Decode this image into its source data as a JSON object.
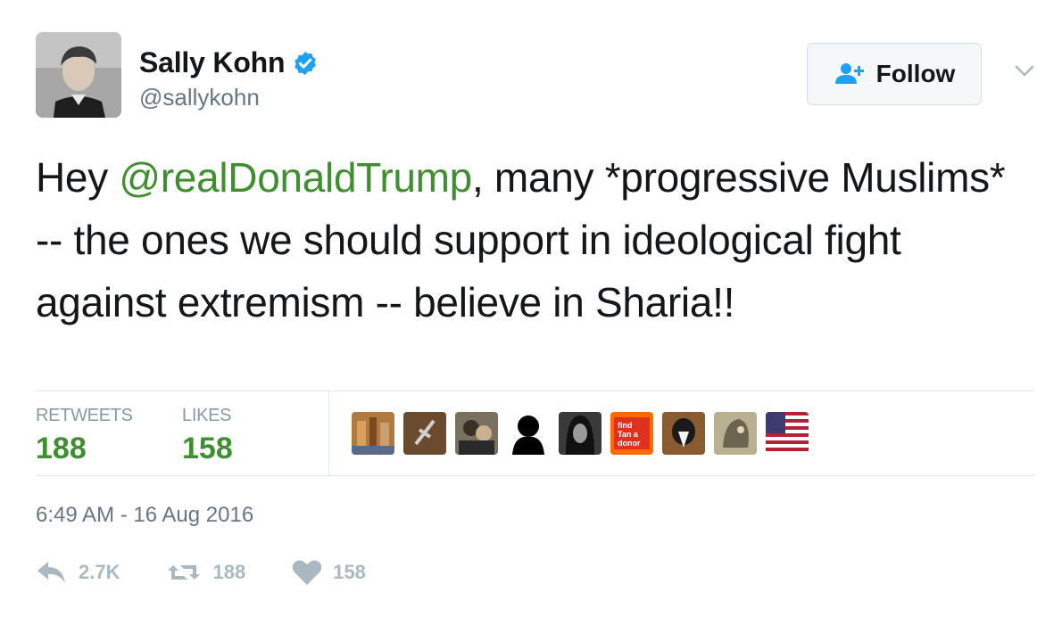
{
  "author": {
    "name": "Sally Kohn",
    "handle": "@sallykohn"
  },
  "follow_button": {
    "label": "Follow"
  },
  "tweet": {
    "before_mention": "Hey ",
    "mention": "@realDonaldTrump",
    "after_mention": ", many *progressive Muslims* -- the ones we should support in ideological fight against extremism -- believe in Sharia!!"
  },
  "stats": {
    "retweets_label": "RETWEETS",
    "retweets_value": "188",
    "likes_label": "LIKES",
    "likes_value": "158"
  },
  "likers": [
    {
      "icon": "liker-avatar-1"
    },
    {
      "icon": "liker-avatar-2"
    },
    {
      "icon": "liker-avatar-3"
    },
    {
      "icon": "liker-avatar-4"
    },
    {
      "icon": "liker-avatar-5"
    },
    {
      "icon": "liker-avatar-6",
      "text": "find Tan a donor"
    },
    {
      "icon": "liker-avatar-7"
    },
    {
      "icon": "liker-avatar-8"
    },
    {
      "icon": "liker-avatar-9-flag"
    }
  ],
  "timestamp": "6:49 AM - 16 Aug 2016",
  "actions": {
    "reply_count": "2.7K",
    "retweet_count": "188",
    "like_count": "158"
  },
  "colors": {
    "accent_green": "#3f8f30",
    "muted": "#657786",
    "action_gray": "#aab8c2",
    "verified_blue": "#1da1f2"
  }
}
